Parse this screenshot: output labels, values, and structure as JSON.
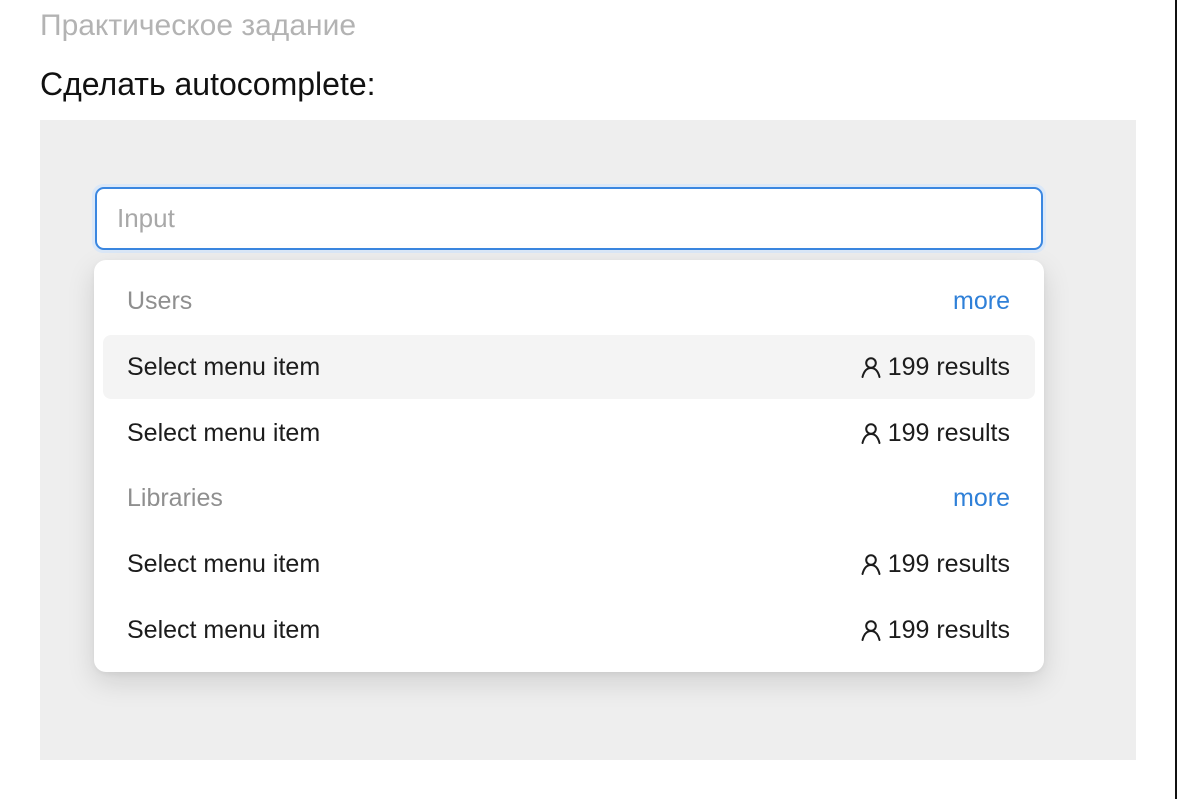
{
  "page": {
    "subtitle": "Практическое задание",
    "heading": "Сделать autocomplete:"
  },
  "search": {
    "placeholder": "Input",
    "value": ""
  },
  "dropdown": {
    "groups": [
      {
        "label": "Users",
        "more_label": "more",
        "items": [
          {
            "label": "Select menu item",
            "count_text": "199 results",
            "icon": "user-icon",
            "highlighted": true
          },
          {
            "label": "Select menu item",
            "count_text": "199 results",
            "icon": "user-icon",
            "highlighted": false
          }
        ]
      },
      {
        "label": "Libraries",
        "more_label": "more",
        "items": [
          {
            "label": "Select menu item",
            "count_text": "199 results",
            "icon": "user-icon",
            "highlighted": false
          },
          {
            "label": "Select menu item",
            "count_text": "199 results",
            "icon": "user-icon",
            "highlighted": false
          }
        ]
      }
    ]
  },
  "colors": {
    "accent": "#3b87e0",
    "link": "#2f80d8",
    "canvas_background": "#eeeeee",
    "highlight": "#f4f4f4"
  }
}
